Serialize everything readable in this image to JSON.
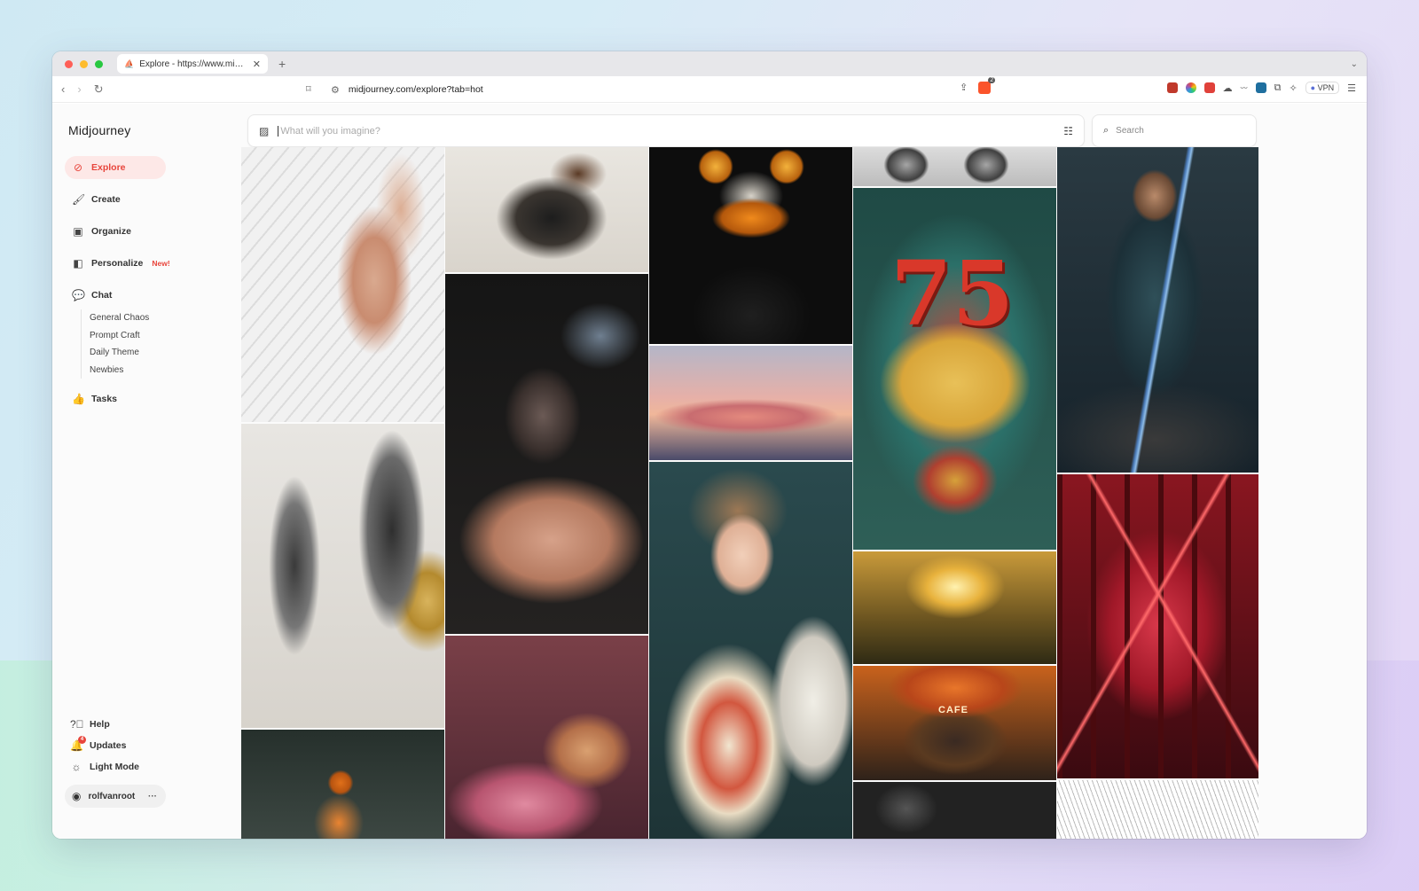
{
  "browser": {
    "tab_title": "Explore - https://www.midjourney.com/explore?tab=hot",
    "url": "midjourney.com/explore?tab=hot",
    "vpn_label": "VPN",
    "shields_count": "2"
  },
  "sidebar": {
    "brand": "Midjourney",
    "nav": [
      {
        "label": "Explore",
        "icon": "compass-icon",
        "active": true
      },
      {
        "label": "Create",
        "icon": "brush-icon"
      },
      {
        "label": "Organize",
        "icon": "image-icon"
      },
      {
        "label": "Personalize",
        "icon": "palette-icon",
        "badge": "New!"
      },
      {
        "label": "Chat",
        "icon": "chat-icon"
      },
      {
        "label": "Tasks",
        "icon": "thumbs-up-icon"
      }
    ],
    "chat_channels": [
      "General Chaos",
      "Prompt Craft",
      "Daily Theme",
      "Newbies"
    ],
    "bottom": {
      "help": "Help",
      "updates": "Updates",
      "updates_count": "4",
      "light_mode": "Light Mode",
      "username": "rolfvanroot",
      "more": "···"
    }
  },
  "prompt": {
    "placeholder": "What will you imagine?"
  },
  "search": {
    "placeholder": "Search"
  },
  "gallery": {
    "cafe_sign": "CAFE",
    "number_art": "75"
  }
}
